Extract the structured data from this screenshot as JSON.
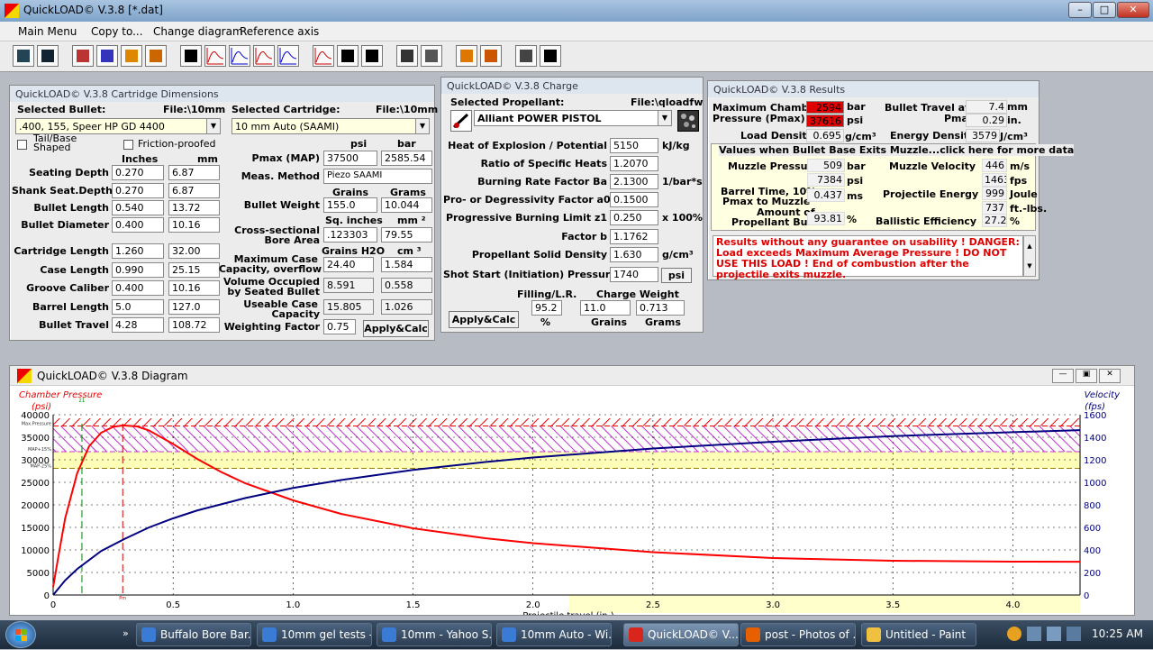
{
  "window": {
    "title": "QuickLOAD© V.3.8   [*.dat]"
  },
  "menu": [
    "Main Menu",
    "Copy to...",
    "Change diagram",
    "Reference axis"
  ],
  "toolbar_icons": [
    "open-icon",
    "save-icon",
    "bullet-db-icon",
    "cartridge-icon",
    "propellant-icon",
    "firearm-icon",
    "table-icon",
    "chart-pressure-icon",
    "chart-velocity-icon",
    "chart-burn-icon",
    "chart-energy-icon",
    "chart-both-icon",
    "report-icon",
    "list-icon",
    "calc-icon",
    "barrel-icon",
    "flame-icon",
    "bars-icon",
    "printer-icon",
    "pistol-icon"
  ],
  "cart": {
    "title": "QuickLOAD© V.3.8 Cartridge Dimensions",
    "sel_bullet_label": "Selected Bullet:",
    "file_label1": "File:\\10mm",
    "bullet": ".400, 155, Speer HP GD 4400",
    "sel_cart_label": "Selected Cartridge:",
    "file_label2": "File:\\10mm",
    "cartridge": "10 mm Auto (SAAMI)",
    "tail_label": "Tail/Base Shaped",
    "friction_label": "Friction-proofed",
    "inches_h": "Inches",
    "mm_h": "mm",
    "rows": [
      {
        "label": "Seating Depth",
        "in": "0.270",
        "mm": "6.87"
      },
      {
        "label": "Shank Seat.Depth",
        "in": "0.270",
        "mm": "6.87"
      },
      {
        "label": "Bullet Length",
        "in": "0.540",
        "mm": "13.72"
      },
      {
        "label": "Bullet Diameter",
        "in": "0.400",
        "mm": "10.16"
      },
      {
        "label": "Cartridge Length",
        "in": "1.260",
        "mm": "32.00"
      },
      {
        "label": "Case Length",
        "in": "0.990",
        "mm": "25.15"
      },
      {
        "label": "Groove Caliber",
        "in": "0.400",
        "mm": "10.16"
      },
      {
        "label": "Barrel Length",
        "in": "5.0",
        "mm": "127.0"
      },
      {
        "label": "Bullet Travel",
        "in": "4.28",
        "mm": "108.72"
      }
    ],
    "psi_h": "psi",
    "bar_h": "bar",
    "pmax_label": "Pmax (MAP)",
    "pmax_psi": "37500",
    "pmax_bar": "2585.54",
    "meas_label": "Meas. Method",
    "meas": "Piezo SAAMI",
    "grains_h": "Grains",
    "grams_h": "Grams",
    "bw_label": "Bullet Weight",
    "bw_gr": "155.0",
    "bw_g": "10.044",
    "sqin_h": "Sq. inches",
    "mm2_h": "mm ²",
    "bore_label1": "Cross-sectional",
    "bore_label2": "Bore Area",
    "bore_in": ".123303",
    "bore_mm": "79.55",
    "h2o_h": "Grains H2O",
    "cm3_h": "cm ³",
    "maxcap_label1": "Maximum Case",
    "maxcap_label2": "Capacity, overflow",
    "maxcap_gr": "24.40",
    "maxcap_cm": "1.584",
    "volocc_label1": "Volume Occupied",
    "volocc_label2": "by Seated Bullet",
    "volocc_gr": "8.591",
    "volocc_cm": "0.558",
    "usecap_label1": "Useable Case",
    "usecap_label2": "Capacity",
    "usecap_gr": "15.805",
    "usecap_cm": "1.026",
    "wf_label": "Weighting Factor",
    "wf": "0.75",
    "apply": "Apply&Calc"
  },
  "charge": {
    "title": "QuickLOAD© V.3.8 Charge",
    "sel_label": "Selected Propellant:",
    "file_label": "File:\\qloadfw",
    "propellant": "Alliant POWER PISTOL",
    "rows": [
      {
        "label": "Heat of Explosion / Potential",
        "val": "5150",
        "unit": "kJ/kg"
      },
      {
        "label": "Ratio of Specific Heats",
        "val": "1.2070",
        "unit": ""
      },
      {
        "label": "Burning Rate Factor  Ba",
        "val": "2.1300",
        "unit": "1/bar*s"
      },
      {
        "label": "Pro- or Degressivity Factor  a0",
        "val": "0.1500",
        "unit": ""
      },
      {
        "label": "Progressive Burning Limit z1",
        "val": "0.250",
        "unit": "x 100%"
      },
      {
        "label": "Factor  b",
        "val": "1.1762",
        "unit": ""
      },
      {
        "label": "Propellant Solid Density",
        "val": "1.630",
        "unit": "g/cm³"
      },
      {
        "label": "Shot Start (Initiation) Pressure",
        "val": "1740",
        "unit": ""
      }
    ],
    "psi_btn": "psi",
    "filling_label": "Filling/L.R.",
    "filling": "95.2",
    "pct": "%",
    "cw_label": "Charge Weight",
    "cw_gr": "11.0",
    "cw_g": "0.713",
    "grains": "Grains",
    "grams": "Grams",
    "apply": "Apply&Calc"
  },
  "results": {
    "title": "QuickLOAD© V.3.8 Results",
    "maxp_label1": "Maximum Chamber",
    "maxp_label2": "Pressure (Pmax)",
    "maxp_bar": "2594",
    "bar": "bar",
    "maxp_psi": "37616",
    "psi": "psi",
    "bt_label1": "Bullet Travel at",
    "bt_label2": "Pmax",
    "bt_mm": "7.4",
    "mm": "mm",
    "bt_in": "0.29",
    "in": "in.",
    "ld_label": "Load Density",
    "ld": "0.695",
    "ld_unit": "g/cm³",
    "ed_label": "Energy Density",
    "ed": "3579",
    "ed_unit": "J/cm³",
    "section": "Values when Bullet Base Exits Muzzle...click here for more data",
    "mp_label": "Muzzle Pressure",
    "mp_bar": "509",
    "mp_psi": "7384",
    "mv_label": "Muzzle Velocity",
    "mv_ms": "446",
    "ms": "m/s",
    "mv_fps": "1463",
    "fps": "fps",
    "bt10_label1": "Barrel Time, 10%",
    "bt10_label2": "Pmax to Muzzle",
    "bt10": "0.437",
    "ms2": "ms",
    "pe_label": "Projectile Energy",
    "pe_j": "999",
    "joule": "Joule",
    "pe_ft": "737",
    "ftlbs": "ft.-lbs.",
    "ab_label1": "Amount of",
    "ab_label2": "Propellant Burnt",
    "ab": "93.81",
    "pct": "%",
    "be_label": "Ballistic Efficiency",
    "be": "27.2",
    "pct2": "%",
    "warning": "Results without any guarantee on usability !  DANGER: Load exceeds Maximum Average Pressure ! DO NOT USE THIS LOAD !   End of combustion after the projectile exits muzzle."
  },
  "diagram": {
    "title": "QuickLOAD© V.3.8 Diagram",
    "left_label": "Chamber Pressure",
    "left_unit": "(psi)",
    "right_label": "Velocity",
    "right_unit": "(fps)",
    "x_label": "Projectile travel (in.)",
    "z1": "z1",
    "pm": "Pm",
    "band_labels": [
      "Max.Pressure",
      "MAP+15%",
      "MAP-25%"
    ]
  },
  "chart_data": {
    "type": "line",
    "xlabel": "Projectile travel (in.)",
    "ylabel": "Chamber Pressure (psi)",
    "y2label": "Velocity (fps)",
    "xlim": [
      0,
      4.28
    ],
    "ylim": [
      0,
      40000
    ],
    "y2lim": [
      0,
      1600
    ],
    "x_ticks": [
      "0",
      "0.5",
      "1.0",
      "1.5",
      "2.0",
      "2.5",
      "3.0",
      "3.5",
      "4.0"
    ],
    "y_ticks": [
      "0",
      "5000",
      "10000",
      "15000",
      "20000",
      "25000",
      "30000",
      "35000",
      "40000"
    ],
    "y2_ticks": [
      "0",
      "200",
      "400",
      "600",
      "800",
      "1000",
      "1200",
      "1400",
      "1600"
    ],
    "series": [
      {
        "name": "Chamber Pressure",
        "color": "#ff0000",
        "x": [
          0,
          0.02,
          0.05,
          0.1,
          0.15,
          0.2,
          0.25,
          0.29,
          0.35,
          0.4,
          0.5,
          0.6,
          0.7,
          0.8,
          1.0,
          1.2,
          1.5,
          1.8,
          2.0,
          2.5,
          3.0,
          3.5,
          4.0,
          4.28
        ],
        "y": [
          1740,
          8000,
          17000,
          27000,
          33000,
          36000,
          37300,
          37616,
          37400,
          36500,
          33500,
          30200,
          27300,
          24800,
          21000,
          18000,
          14800,
          12600,
          11500,
          9500,
          8200,
          7600,
          7400,
          7384
        ]
      },
      {
        "name": "Velocity",
        "color": "#000080",
        "x": [
          0,
          0.05,
          0.1,
          0.2,
          0.3,
          0.4,
          0.5,
          0.6,
          0.8,
          1.0,
          1.2,
          1.5,
          1.8,
          2.0,
          2.5,
          3.0,
          3.5,
          4.0,
          4.28
        ],
        "y": [
          0,
          130,
          230,
          390,
          500,
          600,
          680,
          750,
          860,
          950,
          1020,
          1110,
          1180,
          1220,
          1300,
          1360,
          1410,
          1445,
          1463
        ]
      }
    ],
    "reference_lines": {
      "max_pressure": 37500,
      "map_plus": 31800,
      "map_minus": 28100,
      "z1_x": 0.12,
      "pmax_x": 0.29
    }
  },
  "taskbar": [
    {
      "label": "Buffalo Bore Bar...",
      "color": "#3a7bd5"
    },
    {
      "label": "10mm gel tests - ...",
      "color": "#3a7bd5"
    },
    {
      "label": "10mm - Yahoo S...",
      "color": "#3a7bd5"
    },
    {
      "label": "10mm Auto - Wi...",
      "color": "#3a7bd5"
    },
    {
      "label": "QuickLOAD© V....",
      "color": "#d8261c"
    },
    {
      "label": "post - Photos of ...",
      "color": "#e66000"
    },
    {
      "label": "Untitled - Paint",
      "color": "#f0c040"
    }
  ],
  "clock": "10:25 AM"
}
